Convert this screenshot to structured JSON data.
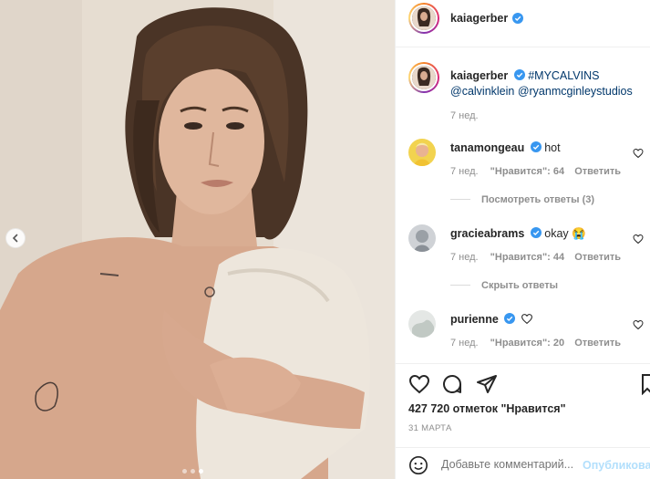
{
  "post": {
    "author": "kaiagerber",
    "caption_hashtag": "#MYCALVINS",
    "caption_mentions": "@calvinklein @ryanmcginleystudios",
    "caption_age": "7 нед."
  },
  "comments": [
    {
      "username": "tanamongeau",
      "text": "hot",
      "age": "7 нед.",
      "likes": "\"Нравится\": 64",
      "reply": "Ответить",
      "thread": "Посмотреть ответы (3)"
    },
    {
      "username": "gracieabrams",
      "text": "okay",
      "emoji": "😭",
      "age": "7 нед.",
      "likes": "\"Нравится\": 44",
      "reply": "Ответить",
      "thread": "Скрыть ответы"
    },
    {
      "username": "purienne",
      "text": "",
      "age": "7 нед.",
      "likes": "\"Нравится\": 20",
      "reply": "Ответить"
    }
  ],
  "likes_count": "427 720 отметок \"Нравится\"",
  "post_date": "31 МАРТА",
  "comment_input": {
    "placeholder": "Добавьте комментарий...",
    "submit": "Опубликовать"
  },
  "carousel": {
    "count": 3,
    "active_index": 2
  },
  "colors": {
    "link": "#00376b",
    "verified": "#3897f0",
    "submit": "#b2dffc",
    "muted": "#8e8e8e"
  },
  "icons": [
    "chevron-left-icon",
    "verified-icon",
    "heart-icon",
    "comment-icon",
    "share-icon",
    "bookmark-icon",
    "emoji-icon"
  ]
}
